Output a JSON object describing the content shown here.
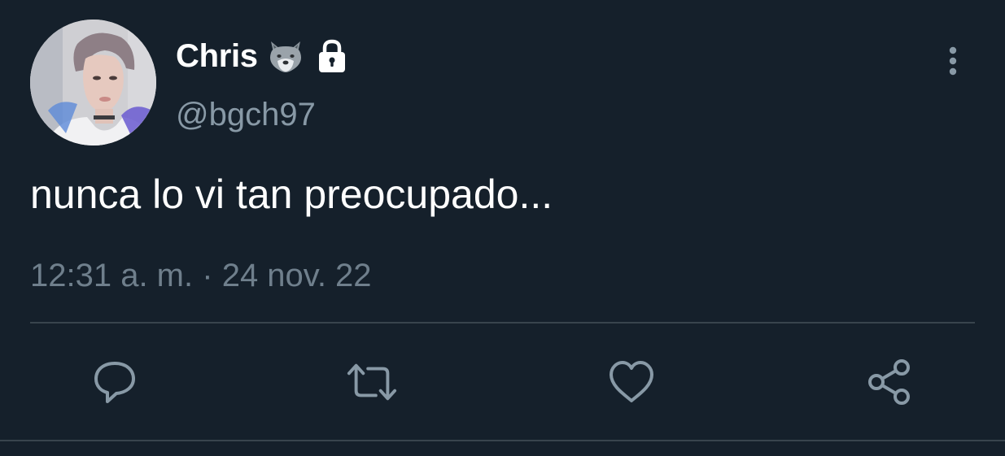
{
  "tweet": {
    "author": {
      "display_name": "Chris",
      "handle": "@bgch97",
      "badges": [
        "wolf-emoji",
        "lock-icon"
      ]
    },
    "text": "nunca lo vi tan preocupado...",
    "time": "12:31 a. m.",
    "separator": "·",
    "date": "24 nov. 22"
  },
  "actions": [
    "reply-icon",
    "retweet-icon",
    "like-icon",
    "share-icon"
  ],
  "colors": {
    "background": "#15202b",
    "text_primary": "#ffffff",
    "text_secondary": "#8899a6",
    "divider": "#38444d",
    "icon": "#8899a6"
  }
}
